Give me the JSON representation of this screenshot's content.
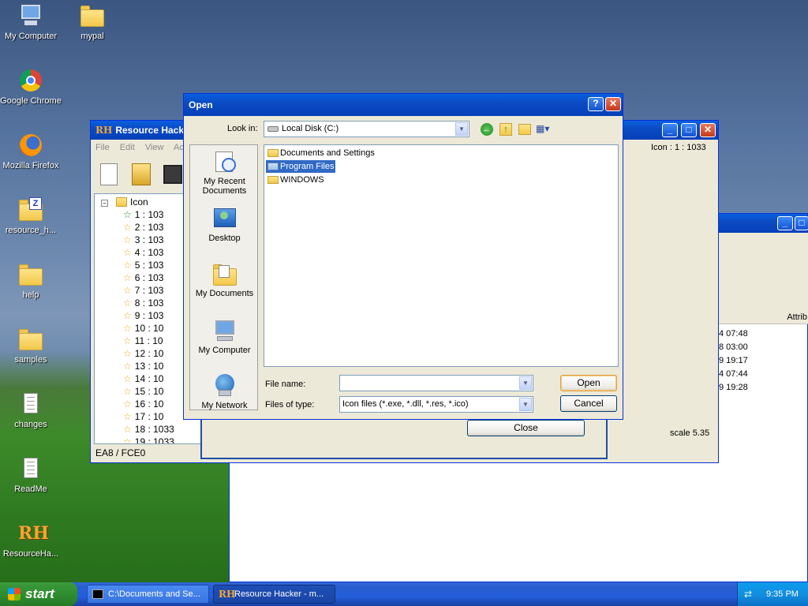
{
  "desktop": {
    "icons": [
      {
        "label": "My Computer"
      },
      {
        "label": "mypal"
      },
      {
        "label": "Google Chrome"
      },
      {
        "label": "Mozilla Firefox"
      },
      {
        "label": "resource_h..."
      },
      {
        "label": "help"
      },
      {
        "label": "samples"
      },
      {
        "label": "changes"
      },
      {
        "label": "ReadMe"
      },
      {
        "label": "ResourceHa..."
      }
    ],
    "rh_logo": "RH"
  },
  "resource_hacker": {
    "title": "Resource Hacker",
    "menu": [
      "File",
      "Edit",
      "View",
      "Act"
    ],
    "info": "Icon : 1 : 1033",
    "tree_root": "Icon",
    "tree_items": [
      "1 : 103",
      "2 : 103",
      "3 : 103",
      "4 : 103",
      "5 : 103",
      "6 : 103",
      "7 : 103",
      "8 : 103",
      "9 : 103",
      "10 : 10",
      "11 : 10",
      "12 : 10",
      "13 : 10",
      "14 : 10",
      "15 : 10",
      "16 : 10",
      "17 : 10",
      "18 : 1033",
      "19 : 1033"
    ],
    "status": "EA8 / FCE0",
    "scale": "scale 5.35",
    "close_label": "Close"
  },
  "explorer_bg": {
    "column_header": "Attrib",
    "times": [
      "4 07:48",
      "8 03:00",
      "9 19:17",
      "4 07:44",
      "9 19:28"
    ]
  },
  "open_dialog": {
    "title": "Open",
    "help_glyph": "?",
    "look_in_label": "Look in:",
    "look_in_value": "Local Disk (C:)",
    "places": [
      {
        "label": "My Recent Documents"
      },
      {
        "label": "Desktop"
      },
      {
        "label": "My Documents"
      },
      {
        "label": "My Computer"
      },
      {
        "label": "My Network"
      }
    ],
    "files": [
      {
        "name": "Documents and Settings",
        "selected": false
      },
      {
        "name": "Program Files",
        "selected": true
      },
      {
        "name": "WINDOWS",
        "selected": false
      }
    ],
    "file_name_label": "File name:",
    "file_name_value": "",
    "file_type_label": "Files of type:",
    "file_type_value": "Icon files (*.exe, *.dll, *.res, *.ico)",
    "open_button": "Open",
    "cancel_button": "Cancel"
  },
  "taskbar": {
    "start_label": "start",
    "tasks": [
      {
        "label": "C:\\Documents and Se..."
      },
      {
        "label": "Resource Hacker - m..."
      }
    ],
    "clock": "9:35 PM"
  },
  "colors": {
    "xp_blue": "#0a5fe0",
    "selection": "#316ac5",
    "start_green": "#2f8d2f"
  }
}
